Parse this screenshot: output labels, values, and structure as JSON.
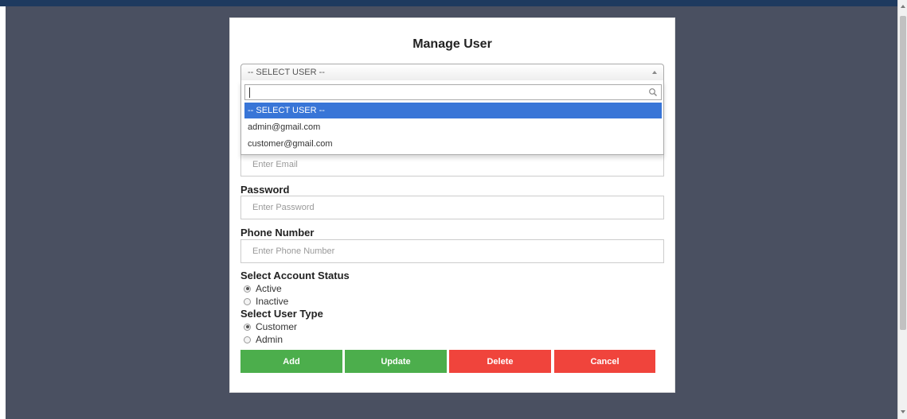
{
  "modal": {
    "title": "Manage User"
  },
  "user_select": {
    "selected": "-- SELECT USER --",
    "search_value": "",
    "options": [
      {
        "label": "-- SELECT USER --",
        "highlighted": true
      },
      {
        "label": "admin@gmail.com",
        "highlighted": false
      },
      {
        "label": "customer@gmail.com",
        "highlighted": false
      }
    ]
  },
  "email": {
    "placeholder": "Enter Email"
  },
  "password": {
    "label": "Password",
    "placeholder": "Enter Password"
  },
  "phone": {
    "label": "Phone Number",
    "placeholder": "Enter Phone Number"
  },
  "account_status": {
    "label": "Select Account Status",
    "options": [
      {
        "label": "Active",
        "checked": true
      },
      {
        "label": "Inactive",
        "checked": false
      }
    ]
  },
  "user_type": {
    "label": "Select User Type",
    "options": [
      {
        "label": "Customer",
        "checked": true
      },
      {
        "label": "Admin",
        "checked": false
      }
    ]
  },
  "buttons": {
    "add": "Add",
    "update": "Update",
    "delete": "Delete",
    "cancel": "Cancel"
  },
  "colors": {
    "overlay": "#4a5061",
    "highlight": "#3875d7",
    "green": "#4cae4c",
    "red": "#f0443c"
  },
  "icons": {
    "search": "search-icon",
    "caret": "caret-up-icon"
  }
}
